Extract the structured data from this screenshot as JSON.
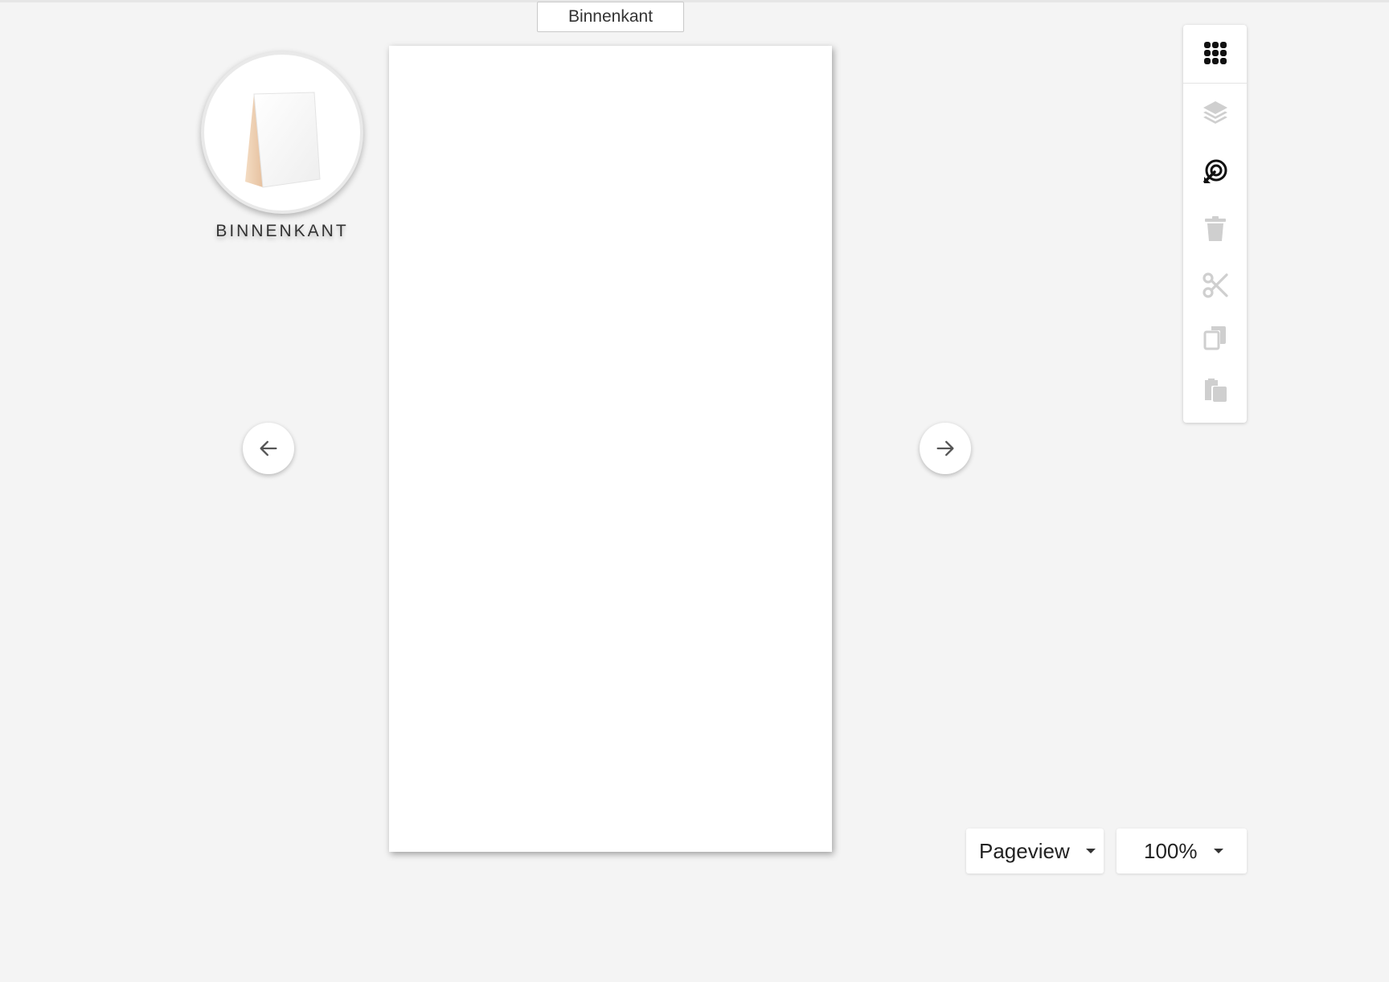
{
  "header": {
    "view_tab_label": "Binnenkant"
  },
  "side_panel": {
    "label": "BINNENKANT",
    "thumbnail_icon": "table-tent-card-icon"
  },
  "navigation": {
    "prev_icon": "arrow-left-icon",
    "next_icon": "arrow-right-icon"
  },
  "toolbar": {
    "tools": [
      {
        "name": "grid-icon",
        "state": "active"
      },
      {
        "name": "layers-icon",
        "state": "disabled"
      },
      {
        "name": "target-arrow-icon",
        "state": "active"
      },
      {
        "name": "trash-icon",
        "state": "disabled"
      },
      {
        "name": "scissors-icon",
        "state": "disabled"
      },
      {
        "name": "copy-icon",
        "state": "disabled"
      },
      {
        "name": "paste-icon",
        "state": "disabled"
      }
    ]
  },
  "footer": {
    "view_mode": "Pageview",
    "zoom": "100%"
  },
  "colors": {
    "background": "#f4f4f4",
    "icon_active": "#111111",
    "icon_disabled": "#cfcfcf",
    "card_side": "#efd3b7"
  }
}
